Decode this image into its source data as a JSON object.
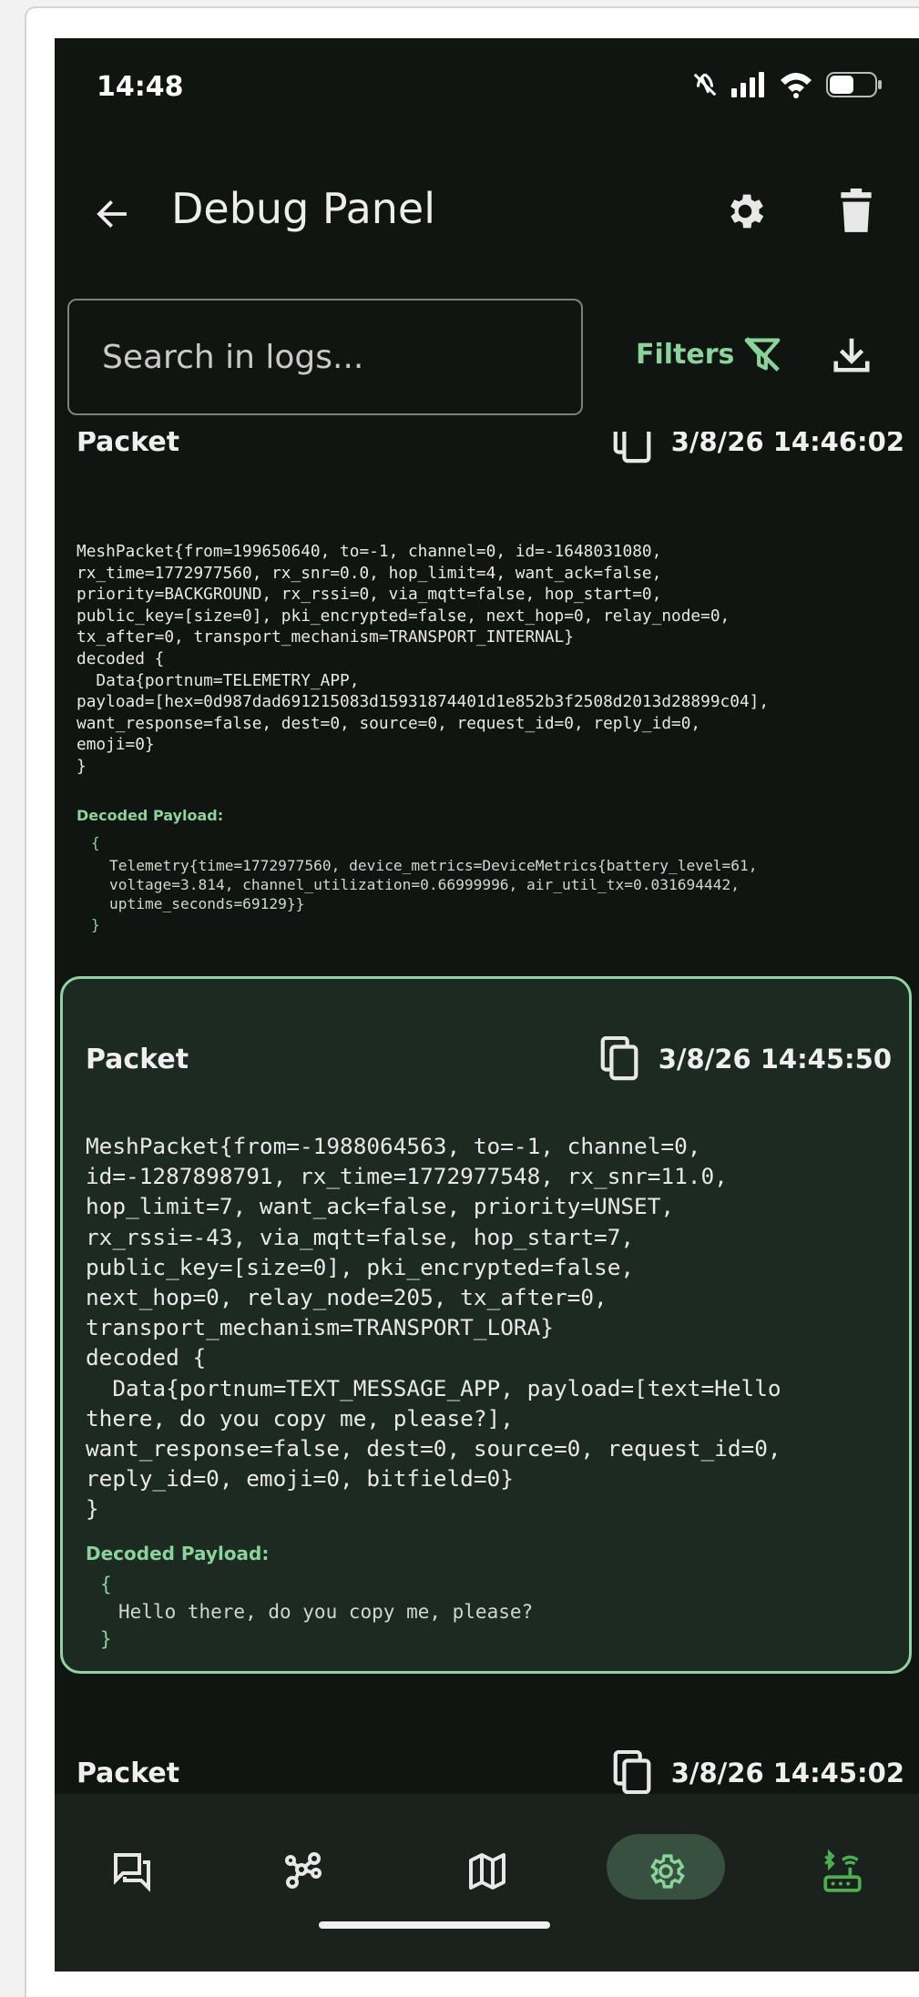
{
  "status_bar": {
    "time": "14:48"
  },
  "header": {
    "title": "Debug Panel"
  },
  "search": {
    "placeholder": "Search in logs..."
  },
  "toolbar": {
    "filters_label": "Filters"
  },
  "entries": [
    {
      "label": "Packet",
      "timestamp": "3/8/26 14:46:02",
      "body": "MeshPacket{from=199650640, to=-1, channel=0, id=-1648031080,\nrx_time=1772977560, rx_snr=0.0, hop_limit=4, want_ack=false,\npriority=BACKGROUND, rx_rssi=0, via_mqtt=false, hop_start=0,\npublic_key=[size=0], pki_encrypted=false, next_hop=0, relay_node=0,\ntx_after=0, transport_mechanism=TRANSPORT_INTERNAL}\ndecoded {\n  Data{portnum=TELEMETRY_APP,\npayload=[hex=0d987dad691215083d15931874401d1e852b3f2508d2013d28899c04],\nwant_response=false, dest=0, source=0, request_id=0, reply_id=0,\nemoji=0}\n}",
      "decoded_label": "Decoded Payload:",
      "decoded_open": "{",
      "decoded_text": "Telemetry{time=1772977560, device_metrics=DeviceMetrics{battery_level=61,\nvoltage=3.814, channel_utilization=0.66999996, air_util_tx=0.031694442,\nuptime_seconds=69129}}",
      "decoded_close": "}"
    },
    {
      "label": "Packet",
      "timestamp": "3/8/26 14:45:50",
      "body": "MeshPacket{from=-1988064563, to=-1, channel=0,\nid=-1287898791, rx_time=1772977548, rx_snr=11.0,\nhop_limit=7, want_ack=false, priority=UNSET,\nrx_rssi=-43, via_mqtt=false, hop_start=7,\npublic_key=[size=0], pki_encrypted=false,\nnext_hop=0, relay_node=205, tx_after=0,\ntransport_mechanism=TRANSPORT_LORA}\ndecoded {\n  Data{portnum=TEXT_MESSAGE_APP, payload=[text=Hello\nthere, do you copy me, please?],\nwant_response=false, dest=0, source=0, request_id=0,\nreply_id=0, emoji=0, bitfield=0}\n}",
      "decoded_label": "Decoded Payload:",
      "decoded_open": "{",
      "decoded_text": "Hello there, do you copy me, please?",
      "decoded_close": "}"
    },
    {
      "label": "Packet",
      "timestamp": "3/8/26 14:45:02"
    }
  ],
  "colors": {
    "accent": "#8ad39b",
    "background": "#111511",
    "card_highlight": "#1d2a22",
    "nav_active": "#37503f"
  },
  "nav": {
    "active": "settings"
  },
  "icons": [
    "back-arrow-icon",
    "gear-icon",
    "trash-icon",
    "filter-off-icon",
    "download-icon",
    "copy-icon",
    "chat-icon",
    "nodes-icon",
    "map-icon",
    "settings-icon",
    "router-bluetooth-icon"
  ]
}
